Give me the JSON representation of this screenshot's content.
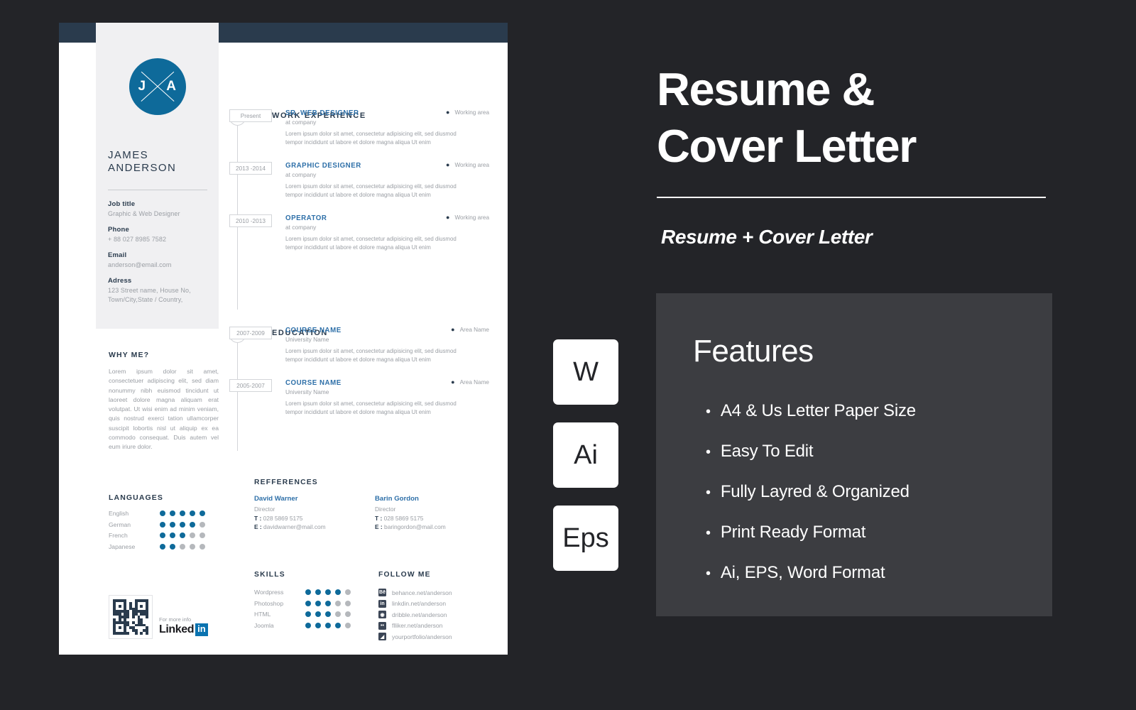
{
  "theme": {
    "page_bg": "#232428",
    "accent_blue": "#0e6a9a",
    "link_blue": "#2d6fa8",
    "navy": "#2a3b4d",
    "panel_gray": "#3c3d41",
    "sidebar_gray": "#f0f0f2",
    "muted": "#9a9ea4"
  },
  "resume": {
    "monogram": {
      "left_letter": "J",
      "right_letter": "A"
    },
    "name": "JAMES\nANDERSON",
    "name_line1": "JAMES",
    "name_line2": "ANDERSON",
    "contact": [
      {
        "label": "Job title",
        "value": "Graphic & Web Designer"
      },
      {
        "label": "Phone",
        "value": "+ 88 027 8985 7582"
      },
      {
        "label": "Email",
        "value": "anderson@email.com"
      },
      {
        "label": "Adress",
        "value": "123 Street name, House No,\nTown/City,State / Country,"
      }
    ],
    "why_me": {
      "heading": "WHY ME?",
      "text": "Lorem ipsum dolor sit amet, consectetuer adipiscing elit, sed diam nonummy nibh euismod tincidunt ut laoreet dolore magna aliquam erat volutpat. Ut wisi enim ad minim veniam, quis nostrud exerci tation ullamcorper suscipit lobortis nisl ut aliquip ex ea commodo consequat. Duis autem vel eum iriure dolor."
    },
    "languages": {
      "heading": "LANGUAGES",
      "max": 5,
      "items": [
        {
          "label": "English",
          "level": 5
        },
        {
          "label": "German",
          "level": 4
        },
        {
          "label": "French",
          "level": 3
        },
        {
          "label": "Japanese",
          "level": 2
        }
      ]
    },
    "qr": {
      "more_info": "For more info",
      "brand_word": "Linked",
      "brand_badge": "in"
    },
    "work_experience": {
      "heading": "WORK EXPERIENCE",
      "icon": "briefcase-icon",
      "entries": [
        {
          "date": "Present",
          "title": "SR. WEB DESIGNER",
          "subtitle": "at company",
          "area": "Working area",
          "desc": "Lorem ipsum dolor sit amet, consectetur adipisicing elit, sed diusmod tempor incididunt ut labore et dolore magna aliqua Ut enim"
        },
        {
          "date": "2013 -2014",
          "title": "GRAPHIC DESIGNER",
          "subtitle": "at company",
          "area": "Working area",
          "desc": "Lorem ipsum dolor sit amet, consectetur adipisicing elit, sed diusmod tempor incididunt ut labore et dolore magna aliqua Ut enim"
        },
        {
          "date": "2010 -2013",
          "title": "OPERATOR",
          "subtitle": "at company",
          "area": "Working area",
          "desc": "Lorem ipsum dolor sit amet, consectetur adipisicing elit, sed diusmod tempor incididunt ut labore et dolore magna aliqua Ut enim"
        }
      ]
    },
    "education": {
      "heading": "EDUCATION",
      "icon": "book-icon",
      "entries": [
        {
          "date": "2007-2009",
          "title": "COURSE NAME",
          "subtitle": "University Name",
          "area": "Area Name",
          "desc": "Lorem ipsum dolor sit amet, consectetur adipisicing elit, sed diusmod tempor incididunt ut labore et dolore magna aliqua Ut enim"
        },
        {
          "date": "2005-2007",
          "title": "COURSE NAME",
          "subtitle": "University Name",
          "area": "Area Name",
          "desc": "Lorem ipsum dolor sit amet, consectetur adipisicing elit, sed diusmod tempor incididunt ut labore et dolore magna aliqua Ut enim"
        }
      ]
    },
    "references": {
      "heading": "REFFERENCES",
      "items": [
        {
          "name": "David Warner",
          "role": "Director",
          "phone_label": "T :",
          "phone": "028 5869 5175",
          "email_label": "E :",
          "email": "davidwarner@mail.com"
        },
        {
          "name": "Barin Gordon",
          "role": "Director",
          "phone_label": "T :",
          "phone": "028 5869 5175",
          "email_label": "E :",
          "email": "baringordon@mail.com"
        }
      ]
    },
    "skills": {
      "heading": "SKILLS",
      "max": 5,
      "items": [
        {
          "label": "Wordpress",
          "level": 4
        },
        {
          "label": "Photoshop",
          "level": 3
        },
        {
          "label": "HTML",
          "level": 3
        },
        {
          "label": "Joomla",
          "level": 4
        }
      ]
    },
    "follow_me": {
      "heading": "FOLLOW ME",
      "items": [
        {
          "icon": "behance-icon",
          "glyph": "Bē",
          "url": "behance.net/anderson"
        },
        {
          "icon": "linkedin-icon",
          "glyph": "in",
          "url": "linkdin.net/anderson"
        },
        {
          "icon": "dribbble-icon",
          "glyph": "◉",
          "url": "dribble.net/anderson"
        },
        {
          "icon": "flickr-icon",
          "glyph": "••",
          "url": "flliker.net/anderson"
        },
        {
          "icon": "portfolio-icon",
          "glyph": "◢",
          "url": "yourportfolio/anderson"
        }
      ]
    }
  },
  "promo": {
    "title_line1": "Resume &",
    "title_line2": "Cover  Letter",
    "subtitle": "Resume + Cover Letter",
    "features": {
      "heading": "Features",
      "bullet": "•",
      "items": [
        "A4 & Us Letter Paper Size",
        "Easy To Edit",
        "Fully Layred & Organized",
        "Print Ready Format",
        "Ai, EPS, Word Format"
      ]
    },
    "format_badges": [
      "W",
      "Ai",
      "Eps"
    ]
  }
}
